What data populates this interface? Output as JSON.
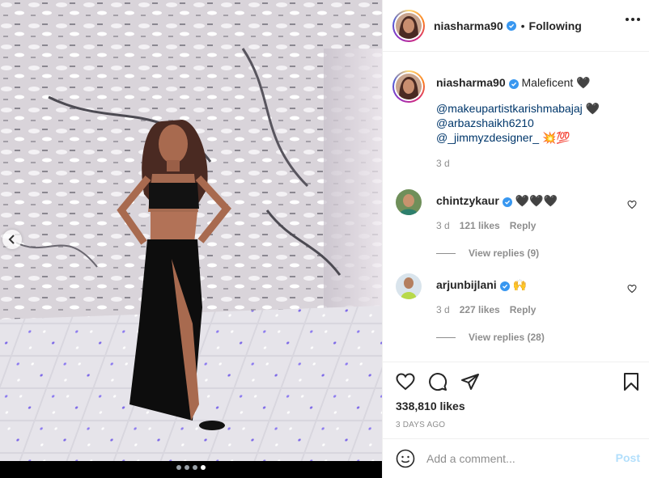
{
  "post": {
    "username": "niasharma90",
    "follow_status": "Following",
    "separator": "•",
    "caption": {
      "text": "Maleficent",
      "emoji": "🖤",
      "mentions": [
        {
          "handle": "@makeupartistkarishmabajaj",
          "emoji": "🖤"
        },
        {
          "handle": "@arbazshaikh6210",
          "emoji": ""
        },
        {
          "handle": "@_jimmyzdesigner_",
          "emoji": "💥💯"
        }
      ],
      "age": "3 d"
    },
    "comments": [
      {
        "username": "chintzykaur",
        "text": "🖤🖤🖤",
        "age": "3 d",
        "likes": "121 likes",
        "reply_label": "Reply",
        "view_replies": "View replies (9)"
      },
      {
        "username": "arjunbijlani",
        "text": "🙌",
        "age": "3 d",
        "likes": "227 likes",
        "reply_label": "Reply",
        "view_replies": "View replies (28)"
      }
    ],
    "like_count": "338,810 likes",
    "posted_date": "3 DAYS AGO",
    "add_comment_placeholder": "Add a comment...",
    "post_button": "Post"
  },
  "carousel": {
    "total": 4,
    "active": 4
  },
  "colors": {
    "verified": "#3897f0",
    "link": "#00376b",
    "muted": "#8e8e8e",
    "post_disabled": "#b2dffc"
  },
  "icons": [
    "verified-badge-icon",
    "more-options-icon",
    "heart-icon",
    "comment-icon",
    "share-icon",
    "bookmark-icon",
    "emoji-icon",
    "chevron-left-icon"
  ]
}
